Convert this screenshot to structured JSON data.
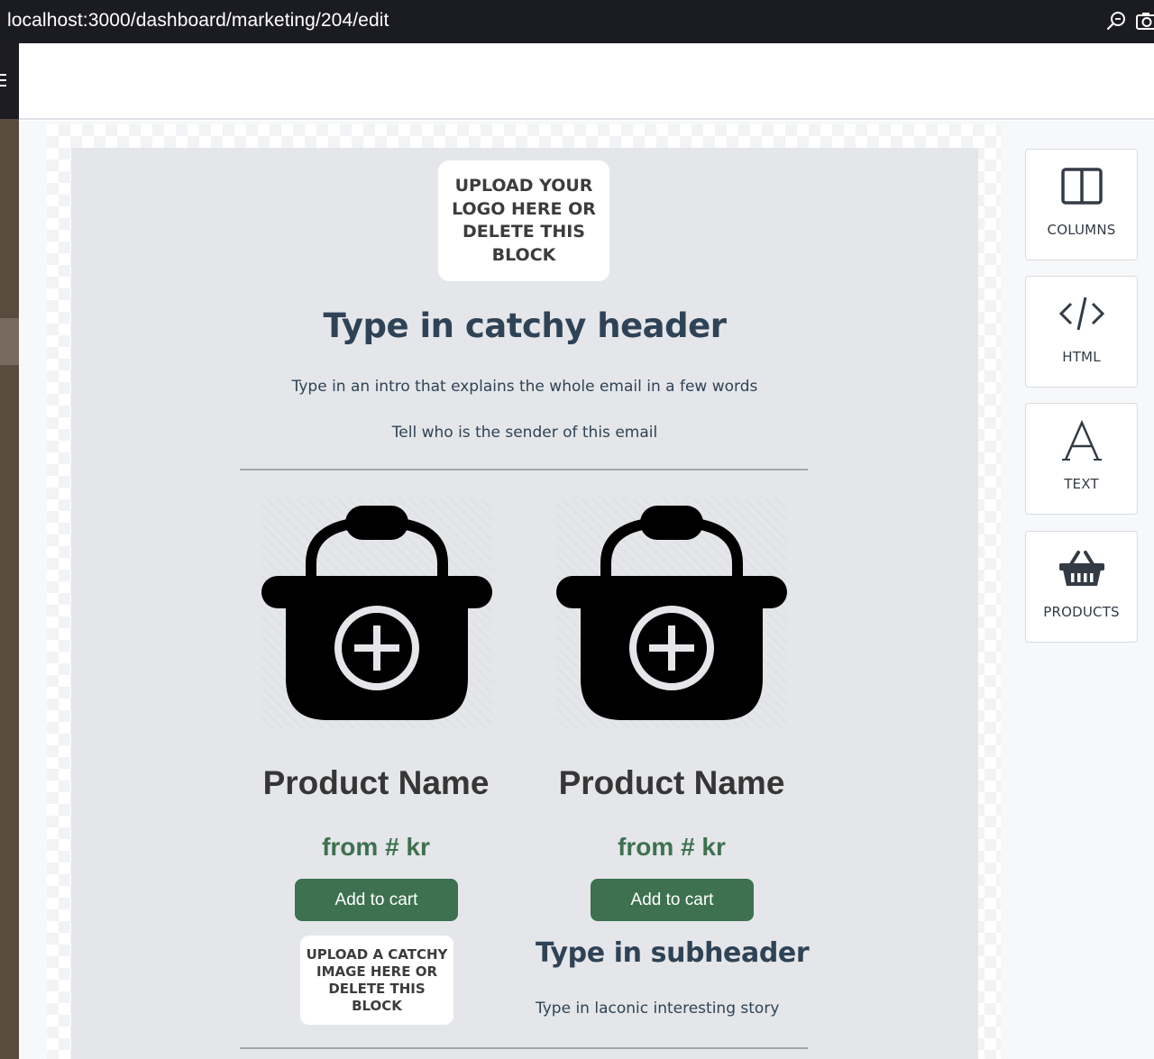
{
  "browser": {
    "url": "localhost:3000/dashboard/marketing/204/edit",
    "icons": [
      "zoom-icon",
      "screenshot-icon"
    ]
  },
  "email": {
    "logo_placeholder": "UPLOAD YOUR LOGO HERE OR DELETE THIS BLOCK",
    "header": "Type in catchy header",
    "intro": "Type in an intro that explains the whole email in a few words",
    "sender": "Tell who is the sender of this email",
    "products": [
      {
        "name": "Product Name",
        "price": "from # kr",
        "button": "Add to cart"
      },
      {
        "name": "Product Name",
        "price": "from # kr",
        "button": "Add to cart"
      }
    ],
    "image_placeholder": "UPLOAD A CATCHY IMAGE HERE OR DELETE THIS BLOCK",
    "subheader": "Type in subheader",
    "story": "Type in laconic interesting story"
  },
  "tools": [
    {
      "label": "COLUMNS",
      "icon": "columns-icon"
    },
    {
      "label": "HTML",
      "icon": "code-icon"
    },
    {
      "label": "TEXT",
      "icon": "text-icon"
    },
    {
      "label": "PRODUCTS",
      "icon": "basket-icon"
    }
  ],
  "colors": {
    "accent_green": "#3d7150",
    "heading_navy": "#2f4356",
    "email_bg": "#e4e6e9",
    "browser_bar": "#1b1b22"
  }
}
